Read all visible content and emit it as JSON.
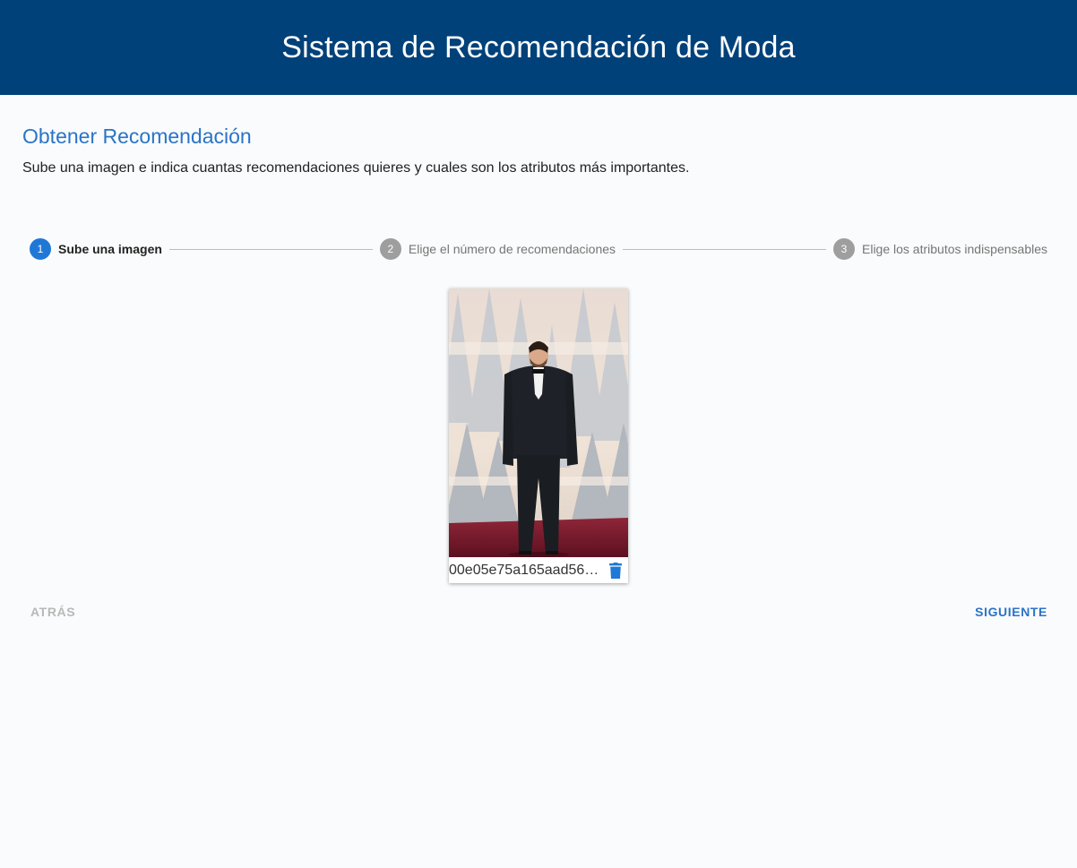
{
  "header": {
    "title": "Sistema de Recomendación de Moda"
  },
  "main": {
    "title": "Obtener Recomendación",
    "description": "Sube una imagen e indica cuantas recomendaciones quieres y cuales son los atributos más importantes."
  },
  "stepper": {
    "steps": [
      {
        "number": "1",
        "label": "Sube una imagen",
        "active": true
      },
      {
        "number": "2",
        "label": "Elige el número de recomendaciones",
        "active": false
      },
      {
        "number": "3",
        "label": "Elige los atributos indispensables",
        "active": false
      }
    ]
  },
  "upload": {
    "filename": "00e05e75a165aad56e…",
    "image_alt": "man in black tuxedo on red carpet",
    "delete_icon": "trash-icon"
  },
  "nav": {
    "back_label": "ATRÁS",
    "next_label": "SIGUIENTE"
  },
  "colors": {
    "header_bg": "#00417a",
    "accent": "#2a74c7",
    "step_active": "#1f78d6",
    "step_inactive": "#9e9e9e"
  }
}
